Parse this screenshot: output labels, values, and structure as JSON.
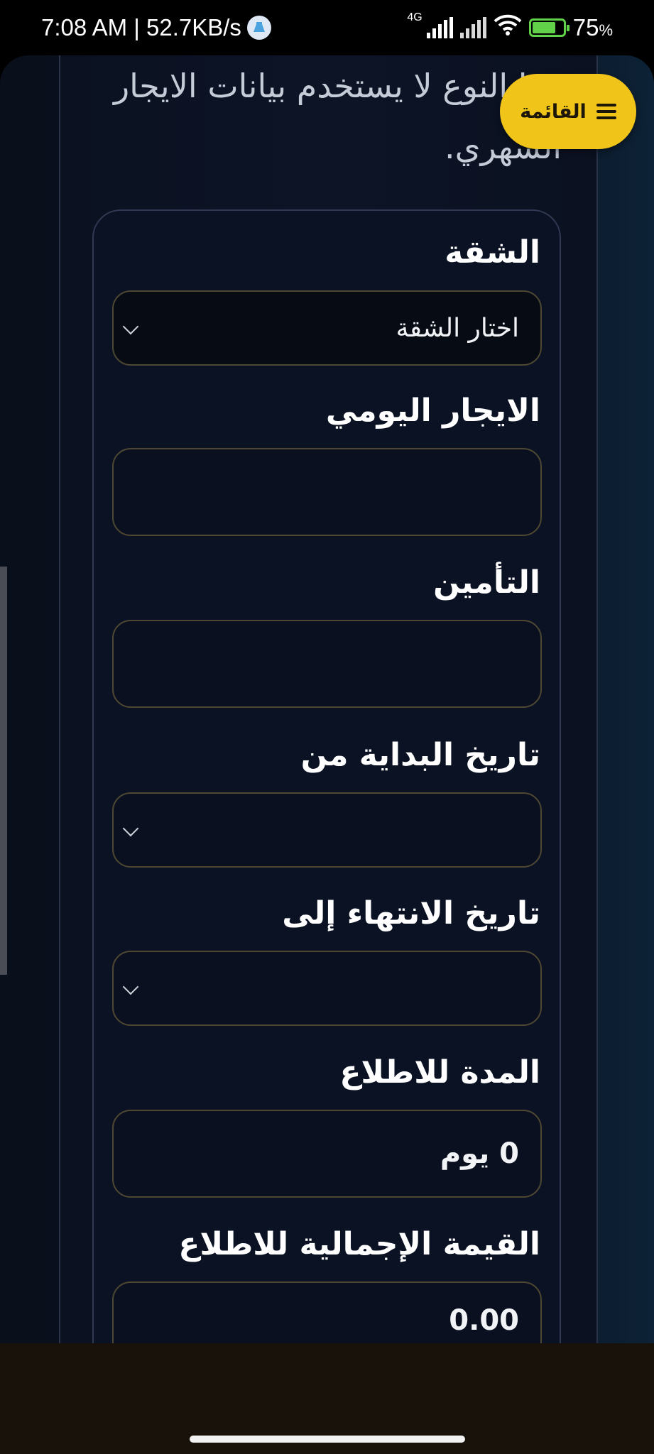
{
  "status_bar": {
    "time_speed": "7:08 AM | 52.7KB/s",
    "network": "4G",
    "battery_percent": "75",
    "battery_unit": "%",
    "battery_level": 0.75,
    "icons": [
      "app-notification-icon",
      "signal-icon",
      "signal-2-icon",
      "wifi-icon",
      "battery-charging-icon"
    ]
  },
  "header": {
    "intro_text": "هذا النوع لا يستخدم بيانات الايجار الشهري."
  },
  "menu_button": {
    "label": "القائمة",
    "icon": "hamburger-icon",
    "color": "#f0c419"
  },
  "form": {
    "apartment": {
      "label": "الشقة",
      "placeholder": "اختار الشقة"
    },
    "daily_rent": {
      "label": "الايجار اليومي",
      "value": ""
    },
    "insurance": {
      "label": "التأمين",
      "value": ""
    },
    "start_date": {
      "label": "تاريخ البداية من",
      "value": ""
    },
    "end_date": {
      "label": "تاريخ الانتهاء إلى",
      "value": ""
    },
    "duration": {
      "label": "المدة للاطلاع",
      "value": "0 يوم"
    },
    "total_value": {
      "label": "القيمة الإجمالية للاطلاع",
      "value": "0.00"
    }
  },
  "colors": {
    "accent": "#f0c419",
    "field_border": "#4e4833",
    "background": "#0b1224"
  }
}
